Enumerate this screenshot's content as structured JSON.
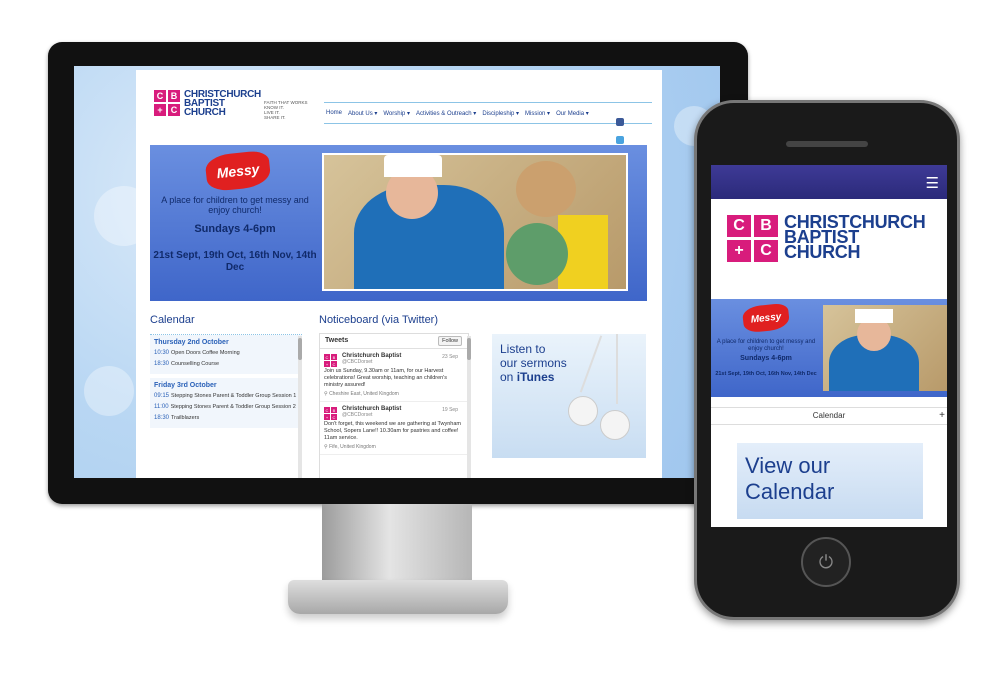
{
  "site": {
    "logo": {
      "letters": [
        "C",
        "B",
        "+",
        "C"
      ],
      "name_line1": "CHRISTCHURCH",
      "name_line2": "BAPTIST",
      "name_line3": "CHURCH",
      "tagline": [
        "FAITH THAT WORKS",
        "KNOW IT.",
        "LIVE IT.",
        "SHARE IT."
      ]
    },
    "nav": [
      "Home",
      "About Us ▾",
      "Worship ▾",
      "Activities & Outreach ▾",
      "Discipleship ▾",
      "Mission ▾",
      "Our Media ▾"
    ],
    "social": [
      {
        "icon": "facebook-icon",
        "color": "#3b5998"
      },
      {
        "icon": "twitter-icon",
        "color": "#4aa3df"
      }
    ],
    "banner": {
      "badge": "Messy",
      "tagline": "A place for children to get messy and enjoy church!",
      "time": "Sundays 4-6pm",
      "dates": "21st Sept, 19th Oct, 16th Nov, 14th Dec"
    },
    "calendar": {
      "title": "Calendar",
      "days": [
        {
          "heading": "Thursday 2nd October",
          "events": [
            {
              "time": "10:30",
              "name": "Open Doors Coffee Morning"
            },
            {
              "time": "18:30",
              "name": "Counselling Course"
            }
          ]
        },
        {
          "heading": "Friday 3rd October",
          "events": [
            {
              "time": "09:15",
              "name": "Stepping Stones Parent & Toddler Group Session 1"
            },
            {
              "time": "11:00",
              "name": "Stepping Stones Parent & Toddler Group Session 2"
            },
            {
              "time": "18:30",
              "name": "Trailblazers"
            }
          ]
        }
      ]
    },
    "noticeboard": {
      "title": "Noticeboard (via Twitter)",
      "header": "Tweets",
      "follow": "Follow",
      "tweets": [
        {
          "name": "Christchurch Baptist",
          "handle": "@CBCDorset",
          "date": "23 Sep",
          "text": "Join us Sunday, 9.30am or 11am, for our Harvest celebrations! Great worship, teaching an children's ministry assured!",
          "location": "Cheshire East, United Kingdom"
        },
        {
          "name": "Christchurch Baptist",
          "handle": "@CBCDorset",
          "date": "19 Sep",
          "text": "Don't forget, this weekend we are gathering at Twynham School, Sopers Lane!! 10.30am for pastries and coffee! 11am service.",
          "location": "Fife, United Kingdom"
        }
      ]
    },
    "sermons": {
      "line1": "Listen to",
      "line2": "our sermons",
      "line3_pre": "on ",
      "line3_brand": "iTunes"
    }
  },
  "mobile": {
    "menu_icon": "☰",
    "banner": {
      "badge": "Messy",
      "tagline": "A place for children to get messy and enjoy church!",
      "time": "Sundays 4-6pm",
      "dates": "21st Sept, 19th Oct, 16th Nov, 14th Dec"
    },
    "calendar_bar": "Calendar",
    "calendar_plus": "+",
    "view_calendar": "View our Calendar",
    "home_symbol": "⏻"
  },
  "colors": {
    "brand_pink": "#d81c7c",
    "brand_blue": "#1c3f8e",
    "accent_blue": "#2a61b8"
  }
}
